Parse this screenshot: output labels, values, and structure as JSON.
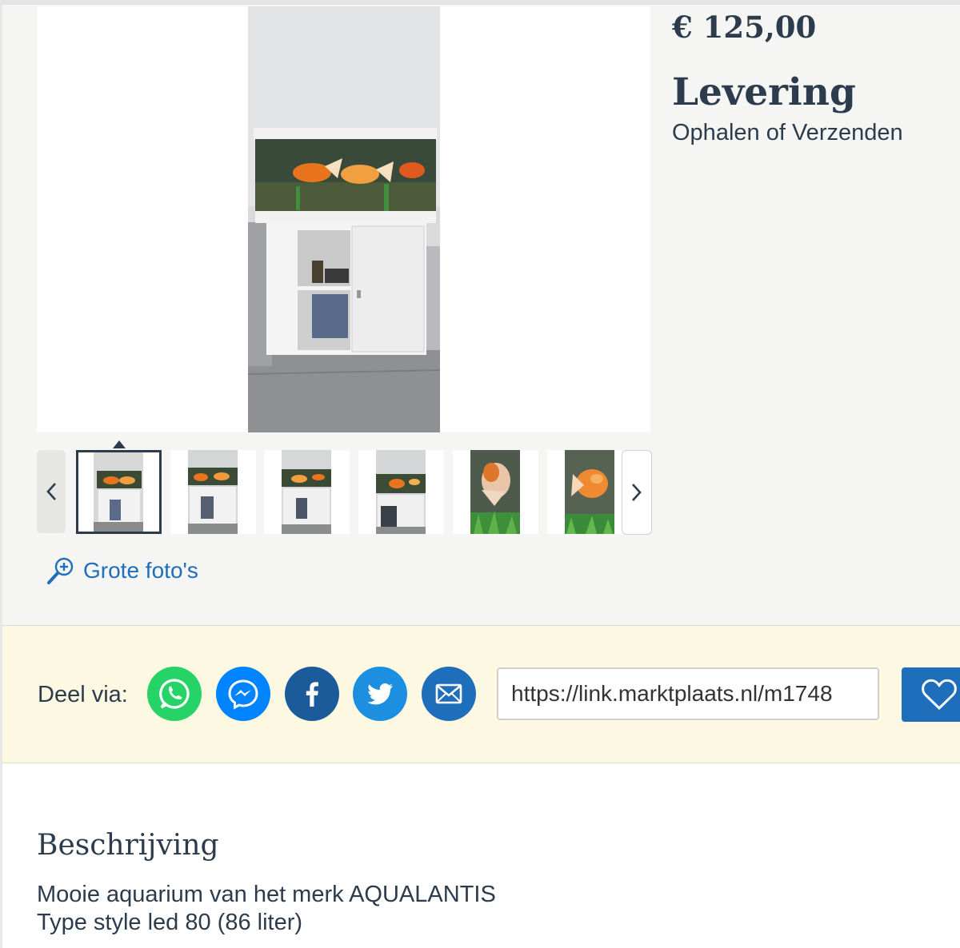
{
  "listing": {
    "price": "€ 125,00",
    "delivery_title": "Levering",
    "delivery_value": "Ophalen of Verzenden"
  },
  "gallery": {
    "thumbnail_count": 6,
    "active_thumbnail": 1,
    "large_photos_label": "Grote foto's"
  },
  "share": {
    "label": "Deel via:",
    "channels": [
      "whatsapp-icon",
      "messenger-icon",
      "facebook-icon",
      "twitter-icon",
      "email-icon"
    ],
    "link_value": "https://link.marktplaats.nl/m1748"
  },
  "description": {
    "title": "Beschrijving",
    "lines": [
      "Mooie aquarium van het merk AQUALANTIS",
      "Type style led 80 (86 liter)"
    ]
  },
  "colors": {
    "accent": "#1f6ebc",
    "text": "#2d3c4d",
    "share_bg": "#fdf8e2",
    "whatsapp": "#25d366",
    "messenger": "#0084ff",
    "facebook": "#1c5b9a",
    "twitter": "#1d8fe0",
    "email": "#1f6ebc"
  }
}
